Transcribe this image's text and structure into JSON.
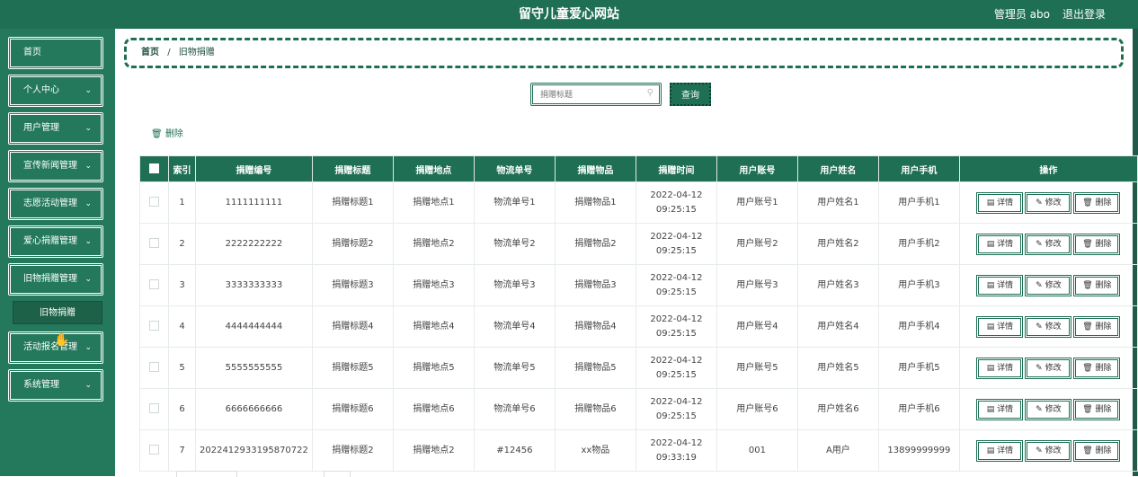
{
  "header": {
    "title": "留守儿童爱心网站",
    "admin_label": "管理员 abo",
    "logout_label": "退出登录"
  },
  "sidebar": {
    "items": [
      {
        "label": "首页",
        "has_children": false
      },
      {
        "label": "个人中心",
        "has_children": true
      },
      {
        "label": "用户管理",
        "has_children": true
      },
      {
        "label": "宣传新闻管理",
        "has_children": true
      },
      {
        "label": "志愿活动管理",
        "has_children": true
      },
      {
        "label": "爱心捐赠管理",
        "has_children": true
      },
      {
        "label": "旧物捐赠管理",
        "has_children": true
      },
      {
        "label": "活动报名管理",
        "has_children": true
      },
      {
        "label": "系统管理",
        "has_children": true
      }
    ],
    "submenu": {
      "label": "旧物捐赠"
    }
  },
  "breadcrumb": {
    "home": "首页",
    "separator": "/",
    "current": "旧物捐赠"
  },
  "search": {
    "placeholder": "捐赠标题",
    "button_label": "查询"
  },
  "toolbar": {
    "delete_label": "删除"
  },
  "table": {
    "headers": [
      "索引",
      "捐赠编号",
      "捐赠标题",
      "捐赠地点",
      "物流单号",
      "捐赠物品",
      "捐赠时间",
      "用户账号",
      "用户姓名",
      "用户手机",
      "操作"
    ],
    "actions": {
      "detail": "详情",
      "edit": "修改",
      "delete": "删除"
    },
    "rows": [
      [
        "1",
        "1111111111",
        "捐赠标题1",
        "捐赠地点1",
        "物流单号1",
        "捐赠物品1",
        "2022-04-12 09:25:15",
        "用户账号1",
        "用户姓名1",
        "用户手机1"
      ],
      [
        "2",
        "2222222222",
        "捐赠标题2",
        "捐赠地点2",
        "物流单号2",
        "捐赠物品2",
        "2022-04-12 09:25:15",
        "用户账号2",
        "用户姓名2",
        "用户手机2"
      ],
      [
        "3",
        "3333333333",
        "捐赠标题3",
        "捐赠地点3",
        "物流单号3",
        "捐赠物品3",
        "2022-04-12 09:25:15",
        "用户账号3",
        "用户姓名3",
        "用户手机3"
      ],
      [
        "4",
        "4444444444",
        "捐赠标题4",
        "捐赠地点4",
        "物流单号4",
        "捐赠物品4",
        "2022-04-12 09:25:15",
        "用户账号4",
        "用户姓名4",
        "用户手机4"
      ],
      [
        "5",
        "5555555555",
        "捐赠标题5",
        "捐赠地点5",
        "物流单号5",
        "捐赠物品5",
        "2022-04-12 09:25:15",
        "用户账号5",
        "用户姓名5",
        "用户手机5"
      ],
      [
        "6",
        "6666666666",
        "捐赠标题6",
        "捐赠地点6",
        "物流单号6",
        "捐赠物品6",
        "2022-04-12 09:25:15",
        "用户账号6",
        "用户姓名6",
        "用户手机6"
      ],
      [
        "7",
        "2022412933195870722",
        "捐赠标题2",
        "捐赠地点2",
        "#12456",
        "xx物品",
        "2022-04-12 09:33:19",
        "001",
        "A用户",
        "13899999999"
      ]
    ]
  }
}
